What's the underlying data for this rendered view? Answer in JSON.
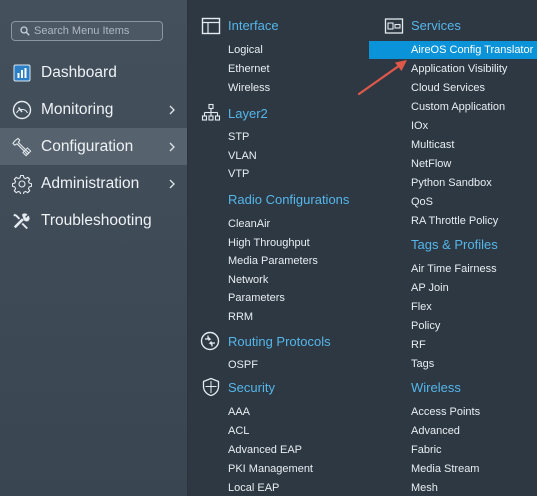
{
  "search": {
    "placeholder": "Search Menu Items"
  },
  "sidebar": {
    "items": [
      {
        "label": "Dashboard"
      },
      {
        "label": "Monitoring"
      },
      {
        "label": "Configuration"
      },
      {
        "label": "Administration"
      },
      {
        "label": "Troubleshooting"
      }
    ]
  },
  "menu": {
    "interface": {
      "title": "Interface",
      "items": [
        "Logical",
        "Ethernet",
        "Wireless"
      ]
    },
    "layer2": {
      "title": "Layer2",
      "items": [
        "STP",
        "VLAN",
        "VTP"
      ]
    },
    "radio": {
      "title": "Radio Configurations",
      "items": [
        "CleanAir",
        "High Throughput",
        "Media Parameters",
        "Network",
        "Parameters",
        "RRM"
      ]
    },
    "routing": {
      "title": "Routing Protocols",
      "items": [
        "OSPF"
      ]
    },
    "security": {
      "title": "Security",
      "items": [
        "AAA",
        "ACL",
        "Advanced EAP",
        "PKI Management",
        "Local EAP"
      ]
    },
    "services": {
      "title": "Services",
      "items": [
        "AireOS Config Translator",
        "Application Visibility",
        "Cloud Services",
        "Custom Application",
        "IOx",
        "Multicast",
        "NetFlow",
        "Python Sandbox",
        "QoS",
        "RA Throttle Policy"
      ]
    },
    "tags": {
      "title": "Tags & Profiles",
      "items": [
        "Air Time Fairness",
        "AP Join",
        "Flex",
        "Policy",
        "RF",
        "Tags"
      ]
    },
    "wireless": {
      "title": "Wireless",
      "items": [
        "Access Points",
        "Advanced",
        "Fabric",
        "Media Stream",
        "Mesh"
      ]
    }
  },
  "colors": {
    "sidebar_bg": "#3e4a56",
    "menu_bg": "#2d3843",
    "active_bg": "#56626d",
    "section_heading": "#55b6ea",
    "highlight": "#0a93d9",
    "annotation_arrow": "#e0584a"
  }
}
